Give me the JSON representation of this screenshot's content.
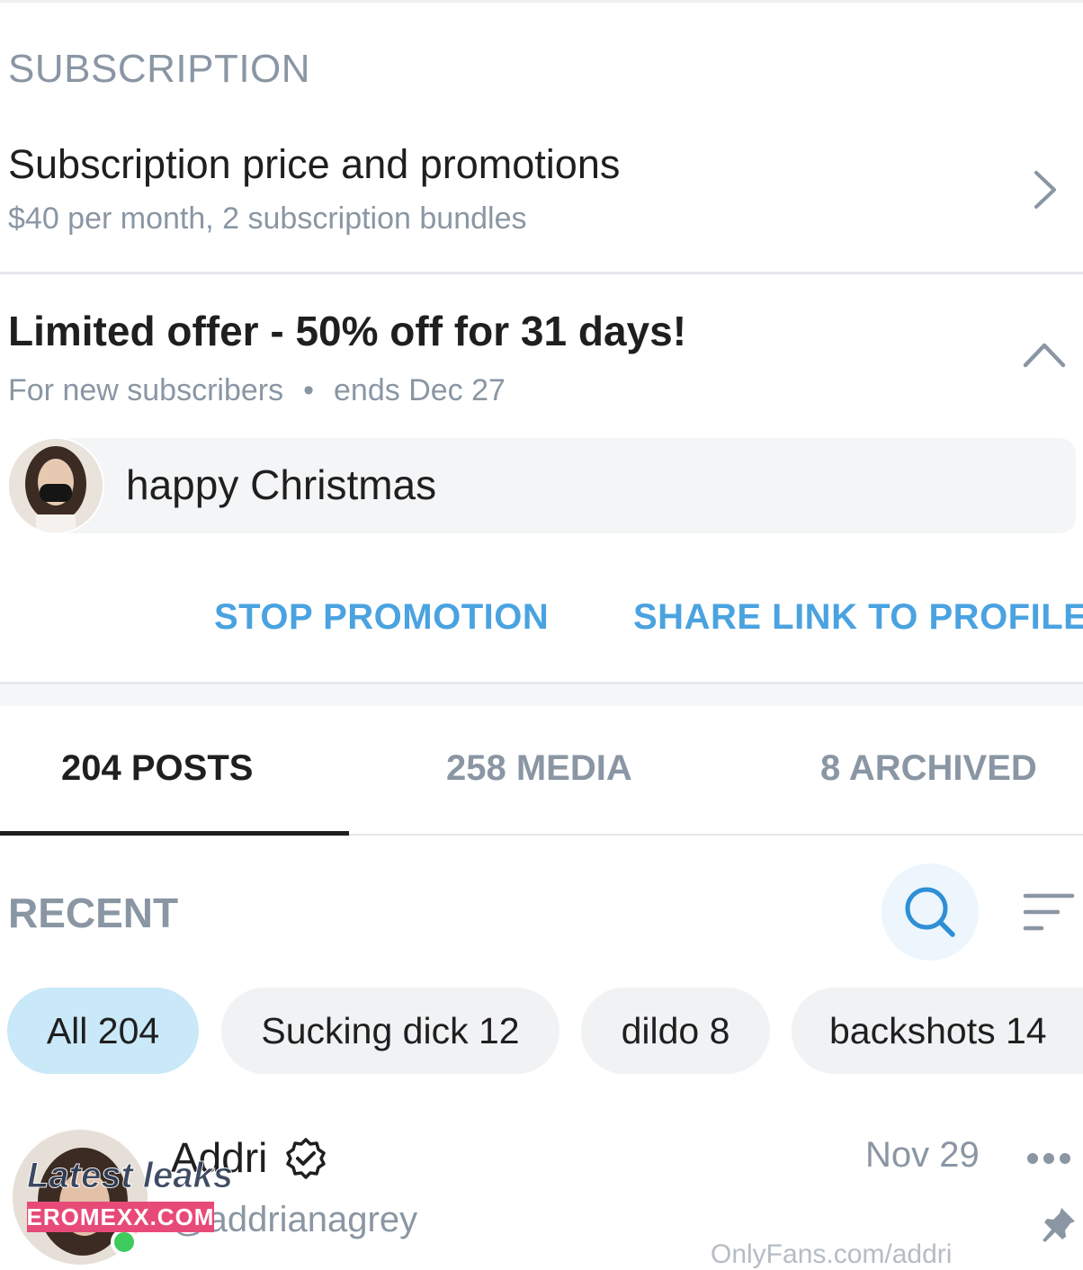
{
  "subscription": {
    "section_title": "SUBSCRIPTION",
    "price_row_title": "Subscription price and promotions",
    "price_row_subtitle": "$40 per month, 2 subscription bundles"
  },
  "promotion": {
    "title": "Limited offer - 50% off for 31 days!",
    "audience": "For new subscribers",
    "separator": "•",
    "ends": "ends Dec 27",
    "message": "happy Christmas",
    "stop_button": "STOP PROMOTION",
    "share_button": "SHARE LINK TO PROFILE"
  },
  "tabs": [
    {
      "label": "204 POSTS",
      "active": true
    },
    {
      "label": "258 MEDIA",
      "active": false
    },
    {
      "label": "8 ARCHIVED",
      "active": false
    }
  ],
  "feed": {
    "sort_label": "RECENT",
    "chips": [
      {
        "label": "All 204",
        "selected": true
      },
      {
        "label": "Sucking dick 12",
        "selected": false
      },
      {
        "label": "dildo 8",
        "selected": false
      },
      {
        "label": "backshots 14",
        "selected": false
      }
    ]
  },
  "post": {
    "author_name": "Addri",
    "handle": "@addrianagrey",
    "date": "Nov 29",
    "partial_text": "OnlyFans.com/addri"
  },
  "watermark": {
    "text": "Latest leaks",
    "badge": "EROMEXX.COM"
  },
  "colors": {
    "accent": "#4aa3e0",
    "muted": "#8a96a3",
    "chip_selected": "#c9e8f8",
    "online": "#3ecb5d"
  },
  "icons": [
    "chevron-right-icon",
    "chevron-up-icon",
    "search-icon",
    "sort-icon",
    "verified-icon",
    "more-icon",
    "pin-icon"
  ]
}
